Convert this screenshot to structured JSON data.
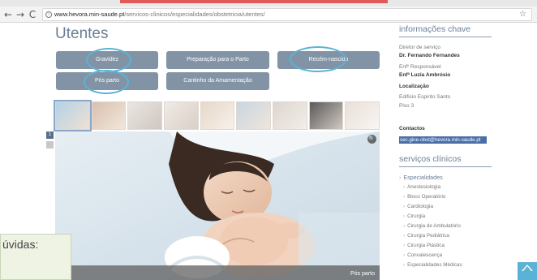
{
  "browser": {
    "back": "←",
    "forward": "→",
    "reload": "C",
    "url_host": "www.hevora.min-saude.pt",
    "url_path": "/servicos-clinicos/especialidades/obstetricia/utentes/",
    "info_glyph": "i",
    "star_glyph": "☆"
  },
  "page": {
    "title": "Utentes",
    "buttons": [
      "Gravidez",
      "Preparação para o Parto",
      "Recém-nascido",
      "Pós parto",
      "Cantinho da Amamentação"
    ],
    "pager": [
      "1",
      ""
    ],
    "hero_caption": "Pós parto",
    "zoom_glyph": "🔍",
    "doubt_text": "úvidas:"
  },
  "sidebar": {
    "key_info_heading": "informações chave",
    "director_label": "Diretor de serviço",
    "director_name": "Dr. Fernando Fernandes",
    "nurse_label": "Enfº Responsável",
    "nurse_name": "Enfª Luzia Ambrósio",
    "location_label": "Localização",
    "building": "Edificio Espirito Santo",
    "floor": "Piso 3",
    "contacts_label": "Contactos",
    "email": "sec.gine-obst@hevora.min-saude.pt",
    "clinical_heading": "serviços clínicos",
    "specialties_label": "Especialidades",
    "specialties": [
      "Anestesiologia",
      "Bloco Operatório",
      "Cardiologia",
      "Cirurgia",
      "Cirurgia de Ambulatório",
      "Cirurgia Pediátrica",
      "Cirurgia Plástica",
      "Convalescença",
      "Especialidades Médicas"
    ]
  },
  "colors": {
    "accent": "#6b7f96",
    "button": "#8393a6",
    "highlight_circle": "#5ab3d6",
    "email_highlight": "#4a6fa8"
  }
}
